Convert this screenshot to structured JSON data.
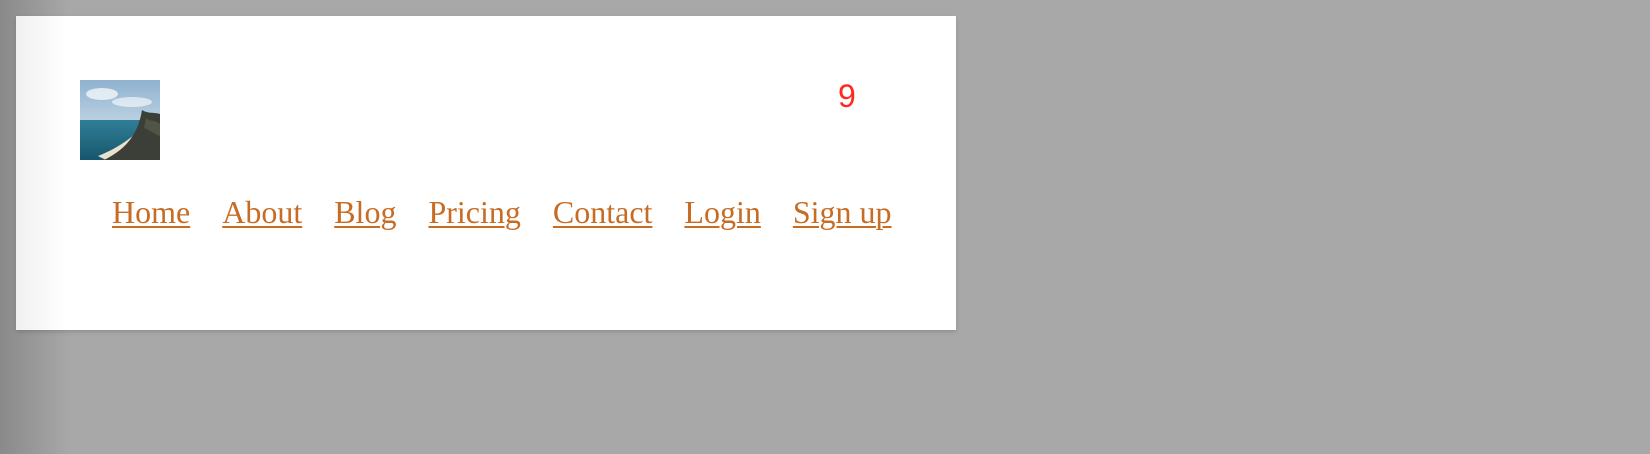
{
  "header": {
    "logo": {
      "icon": "coastal-beach-photo-icon"
    },
    "badge_count": "9"
  },
  "nav": {
    "items": [
      {
        "label": "Home"
      },
      {
        "label": "About"
      },
      {
        "label": "Blog"
      },
      {
        "label": "Pricing"
      },
      {
        "label": "Contact"
      },
      {
        "label": "Login"
      },
      {
        "label": "Sign up"
      }
    ]
  },
  "colors": {
    "page_background": "#a8a8a8",
    "panel_background": "#ffffff",
    "link": "#c86c24",
    "badge": "#ff2a1f"
  }
}
